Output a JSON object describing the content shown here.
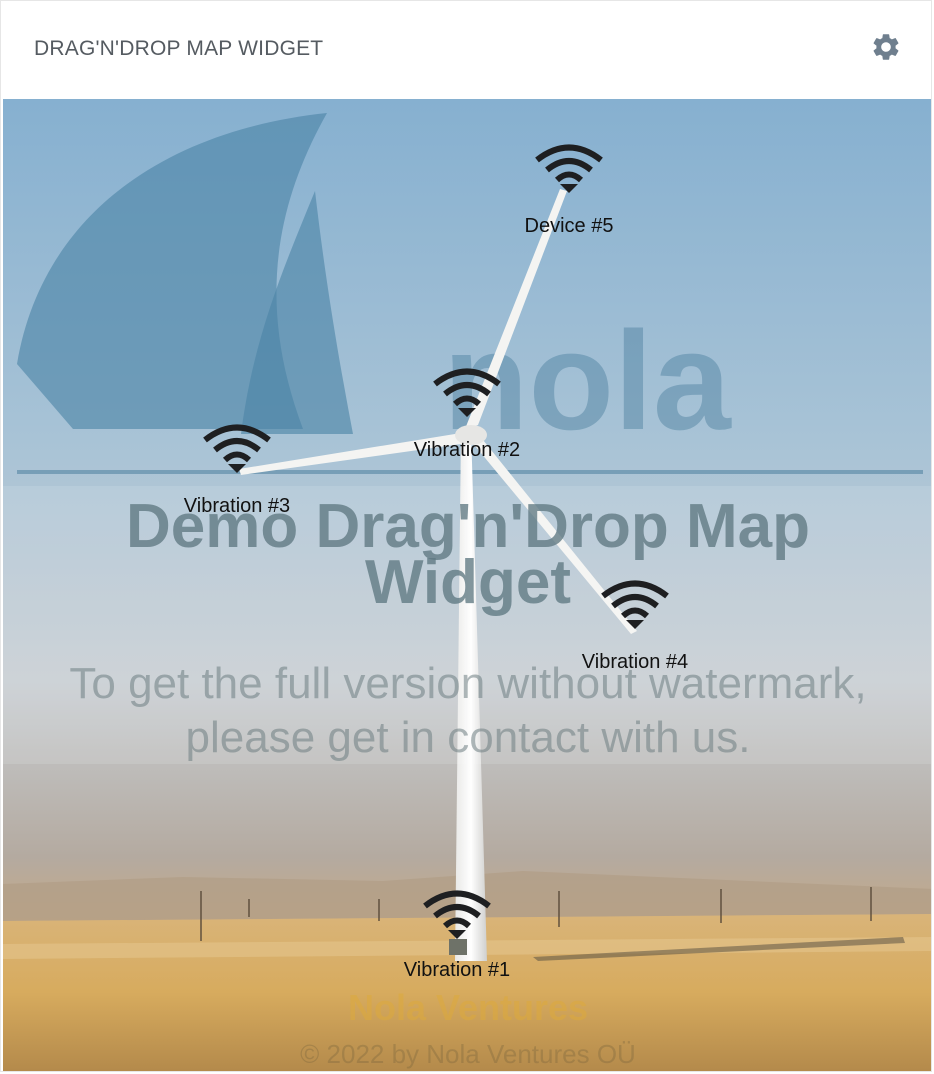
{
  "widget": {
    "title": "DRAG'N'DROP MAP WIDGET",
    "settings_icon": "gear-icon"
  },
  "colors": {
    "title_text": "#555b61",
    "icon_gray": "#6f7f8e",
    "device_icon": "#1e1f21"
  },
  "watermark": {
    "title_line1": "Demo Drag'n'Drop Map",
    "title_line2": "Widget",
    "text_line1": "To get the full version without watermark,",
    "text_line2": "please get in contact with us.",
    "brand": "Nola Ventures",
    "copyright": "© 2022 by Nola Ventures OÜ",
    "logo_text": "nola"
  },
  "devices": [
    {
      "label": "Device #5",
      "icon": "wifi-icon"
    },
    {
      "label": "Vibration #2",
      "icon": "wifi-icon"
    },
    {
      "label": "Vibration #3",
      "icon": "wifi-icon"
    },
    {
      "label": "Vibration #4",
      "icon": "wifi-icon"
    },
    {
      "label": "Vibration #1",
      "icon": "wifi-icon"
    }
  ]
}
